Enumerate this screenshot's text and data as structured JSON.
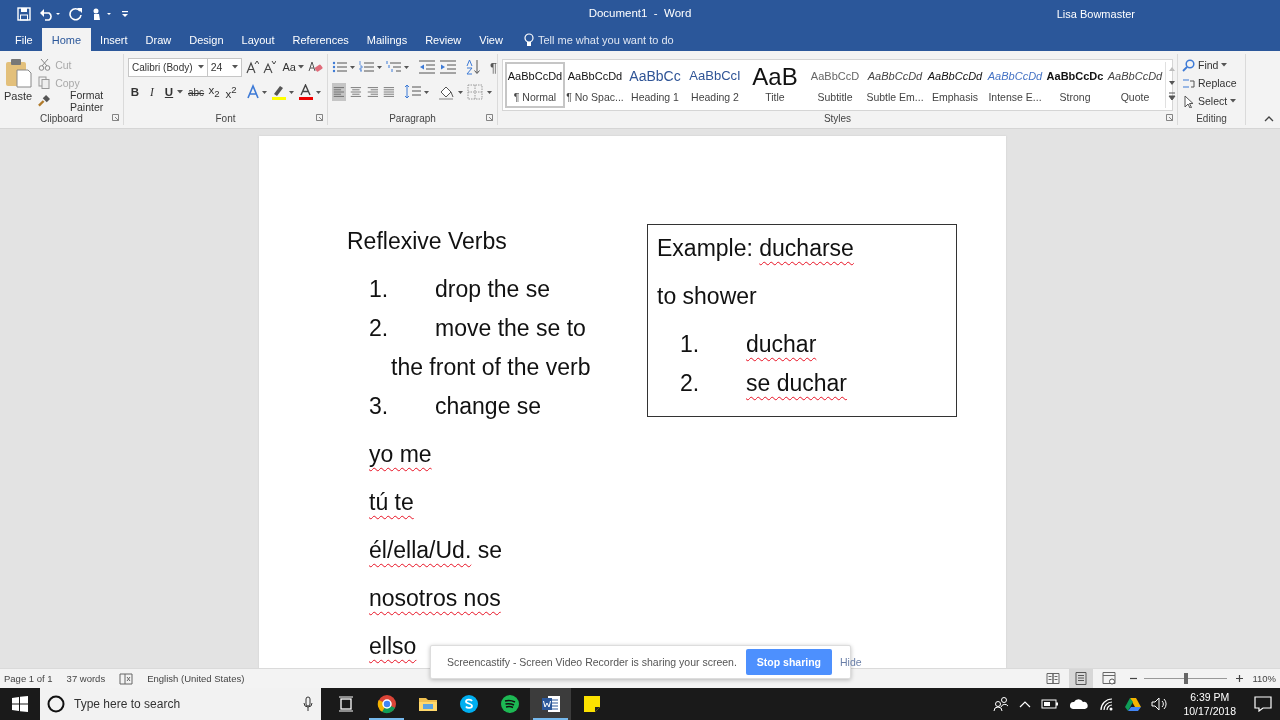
{
  "window": {
    "title": "Document1  -  Word",
    "user": "Lisa Bowmaster"
  },
  "tabs": [
    {
      "label": "File",
      "selected": false
    },
    {
      "label": "Home",
      "selected": true
    },
    {
      "label": "Insert",
      "selected": false
    },
    {
      "label": "Draw",
      "selected": false
    },
    {
      "label": "Design",
      "selected": false
    },
    {
      "label": "Layout",
      "selected": false
    },
    {
      "label": "References",
      "selected": false
    },
    {
      "label": "Mailings",
      "selected": false
    },
    {
      "label": "Review",
      "selected": false
    },
    {
      "label": "View",
      "selected": false
    }
  ],
  "tell_me": {
    "placeholder": "Tell me what you want to do"
  },
  "clipboard": {
    "label": "Clipboard",
    "paste": "Paste",
    "items": [
      {
        "label": "Cut",
        "kind": "cut",
        "disabled": true
      },
      {
        "label": "Copy",
        "kind": "copy",
        "disabled": true
      },
      {
        "label": "Format Painter",
        "kind": "painter",
        "disabled": false
      }
    ]
  },
  "font": {
    "label": "Font",
    "font_name": "Calibri (Body)",
    "font_size": "24",
    "case_button": "Aa",
    "format_buttons": [
      {
        "label": "B",
        "kind": "bold"
      },
      {
        "label": "I",
        "kind": "italic"
      },
      {
        "label": "U",
        "kind": "underline"
      },
      {
        "label": "abc",
        "kind": "strike"
      },
      {
        "label": "x$_{2}$",
        "kind": "plain"
      },
      {
        "label": "x$^{2}$",
        "kind": "plain"
      }
    ]
  },
  "paragraph": {
    "label": "Paragraph",
    "pilcrow": "¶",
    "align_buttons": [
      {
        "kind": "left",
        "selected": true
      },
      {
        "kind": "center",
        "selected": false
      },
      {
        "kind": "right",
        "selected": false
      },
      {
        "kind": "justify",
        "selected": false
      }
    ]
  },
  "styles": {
    "label": "Styles",
    "items": [
      {
        "preview": "AaBbCcDd",
        "name": "¶ Normal",
        "kind": "normal",
        "selected": true
      },
      {
        "preview": "AaBbCcDd",
        "name": "¶ No Spac...",
        "kind": "normal",
        "selected": false
      },
      {
        "preview": "AaBbCc",
        "name": "Heading 1",
        "kind": "heading1",
        "selected": false
      },
      {
        "preview": "AaBbCcI",
        "name": "Heading 2",
        "kind": "heading2",
        "selected": false
      },
      {
        "preview": "AaB",
        "name": "Title",
        "kind": "title",
        "selected": false
      },
      {
        "preview": "AaBbCcD",
        "name": "Subtitle",
        "kind": "subtitle",
        "selected": false
      },
      {
        "preview": "AaBbCcDd",
        "name": "Subtle Em...",
        "kind": "subtle",
        "selected": false
      },
      {
        "preview": "AaBbCcDd",
        "name": "Emphasis",
        "kind": "emphasis",
        "selected": false
      },
      {
        "preview": "AaBbCcDd",
        "name": "Intense E...",
        "kind": "intense",
        "selected": false
      },
      {
        "preview": "AaBbCcDc",
        "name": "Strong",
        "kind": "strong",
        "selected": false
      },
      {
        "preview": "AaBbCcDd",
        "name": "Quote",
        "kind": "quote",
        "selected": false
      }
    ]
  },
  "editing": {
    "label": "Editing",
    "items": [
      {
        "label": "Find",
        "kind": "find"
      },
      {
        "label": "Replace",
        "kind": "replace"
      },
      {
        "label": "Select",
        "kind": "select"
      }
    ]
  },
  "document": {
    "body": [
      {
        "kind": "para",
        "segments": [
          {
            "text": "Reflexive Verbs",
            "misspelled": false
          }
        ]
      },
      {
        "kind": "numbered",
        "number": "1.",
        "segments": [
          {
            "text": "drop the se",
            "misspelled": false
          }
        ]
      },
      {
        "kind": "numbered",
        "number": "2.",
        "segments": [
          {
            "text": "move the se to the front of the verb",
            "misspelled": false
          }
        ]
      },
      {
        "kind": "numbered",
        "number": "3.",
        "segments": [
          {
            "text": "change se",
            "misspelled": false
          }
        ]
      },
      {
        "kind": "para",
        "indented": true,
        "segments": [
          {
            "text": "yo me",
            "misspelled": true
          }
        ]
      },
      {
        "kind": "para",
        "indented": true,
        "segments": [
          {
            "text": "tú te",
            "misspelled": true
          }
        ]
      },
      {
        "kind": "para",
        "indented": true,
        "segments": [
          {
            "text": "él/ella/Ud.",
            "misspelled": true
          },
          {
            "text": " se",
            "misspelled": false
          }
        ]
      },
      {
        "kind": "para",
        "indented": true,
        "segments": [
          {
            "text": "nosotros nos",
            "misspelled": true
          }
        ]
      },
      {
        "kind": "para",
        "indented": true,
        "segments": [
          {
            "text": "ellso",
            "misspelled": true
          }
        ]
      }
    ],
    "text_box": [
      {
        "kind": "para",
        "segments": [
          {
            "text": "Example: ",
            "misspelled": false
          },
          {
            "text": "ducharse",
            "misspelled": true
          }
        ]
      },
      {
        "kind": "para",
        "segments": [
          {
            "text": "to shower",
            "misspelled": false
          }
        ]
      },
      {
        "kind": "numbered",
        "number": "1.",
        "segments": [
          {
            "text": "duchar",
            "misspelled": true
          }
        ]
      },
      {
        "kind": "numbered",
        "number": "2.",
        "segments": [
          {
            "text": "se duchar",
            "misspelled": true
          }
        ]
      }
    ]
  },
  "share_bar": {
    "message": "Screencastify - Screen Video Recorder is sharing your screen.",
    "stop": "Stop sharing",
    "hide": "Hide"
  },
  "status_bar": {
    "page": "Page 1 of 1",
    "words": "37 words",
    "language": "English (United States)",
    "views": [
      {
        "kind": "read",
        "selected": false
      },
      {
        "kind": "print",
        "selected": true
      },
      {
        "kind": "web",
        "selected": false
      }
    ],
    "zoom": {
      "level": 0.5,
      "reading": "110%"
    }
  },
  "taskbar": {
    "search": {
      "placeholder": "Type here to search"
    },
    "apps": [
      {
        "kind": "chrome",
        "running": true,
        "selected": false
      },
      {
        "kind": "folder",
        "running": false,
        "selected": false
      },
      {
        "kind": "skype",
        "running": false,
        "selected": false
      },
      {
        "kind": "spotify",
        "running": false,
        "selected": false
      },
      {
        "kind": "word",
        "running": true,
        "selected": true
      },
      {
        "kind": "notes",
        "running": false,
        "selected": false
      }
    ],
    "time": "6:39 PM",
    "date": "10/17/2018"
  }
}
